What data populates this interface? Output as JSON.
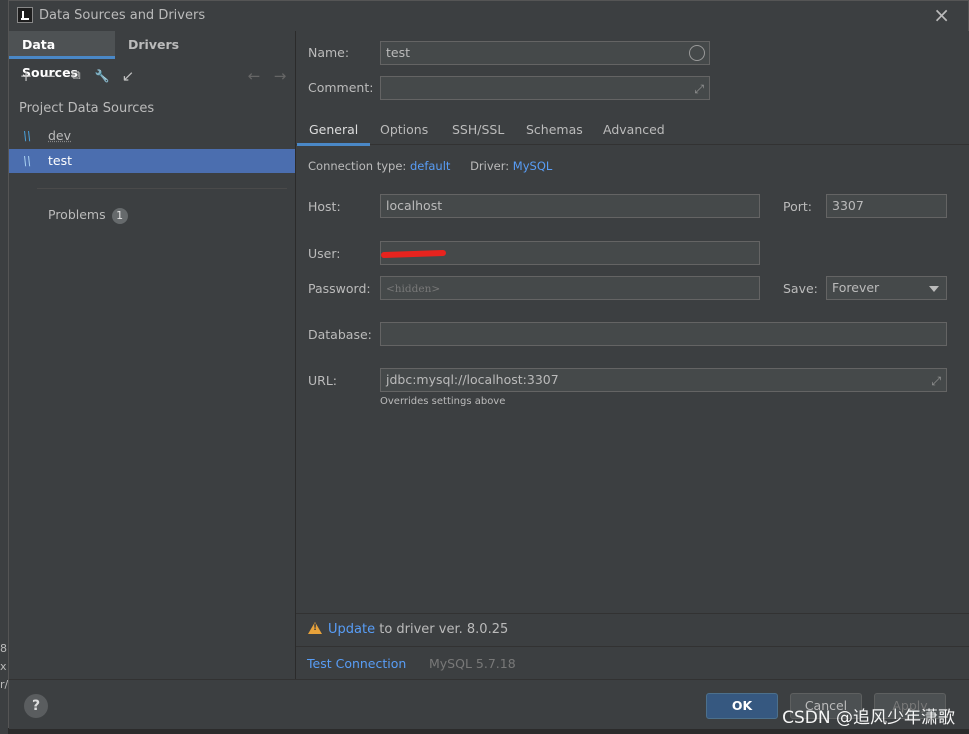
{
  "window": {
    "title": "Data Sources and Drivers"
  },
  "background_fragments": [
    "8",
    "x",
    "r/"
  ],
  "left": {
    "tabs": [
      {
        "label": "Data Sources",
        "active": true
      },
      {
        "label": "Drivers",
        "active": false
      }
    ],
    "toolbar": {
      "add": "+",
      "remove": "−",
      "duplicate": "⧉",
      "properties": "🔧",
      "import": "↙",
      "back": "←",
      "forward": "→"
    },
    "section_title": "Project Data Sources",
    "items": [
      {
        "label": "dev",
        "icon": "mysql-icon",
        "selected": false
      },
      {
        "label": "test",
        "icon": "mysql-icon",
        "selected": true
      }
    ],
    "problems": {
      "label": "Problems",
      "count": "1"
    }
  },
  "form": {
    "name_label": "Name:",
    "name_value": "test",
    "comment_label": "Comment:",
    "comment_value": "",
    "tabs": [
      {
        "label": "General",
        "active": true
      },
      {
        "label": "Options",
        "active": false
      },
      {
        "label": "SSH/SSL",
        "active": false
      },
      {
        "label": "Schemas",
        "active": false
      },
      {
        "label": "Advanced",
        "active": false
      }
    ],
    "conn_type_label": "Connection type:",
    "conn_type_value": "default",
    "driver_label": "Driver:",
    "driver_value": "MySQL",
    "host_label": "Host:",
    "host_value": "localhost",
    "port_label": "Port:",
    "port_value": "3307",
    "user_label": "User:",
    "user_value": "",
    "password_label": "Password:",
    "password_placeholder": "<hidden>",
    "save_label": "Save:",
    "save_value": "Forever",
    "database_label": "Database:",
    "database_value": "",
    "url_label": "URL:",
    "url_value": "jdbc:mysql://localhost:3307",
    "url_hint": "Overrides settings above"
  },
  "notice": {
    "link": "Update",
    "text": " to driver ver. 8.0.25"
  },
  "status": {
    "test_connection": "Test Connection",
    "server_version": "MySQL 5.7.18"
  },
  "footer": {
    "help": "?",
    "ok": "OK",
    "cancel": "Cancel",
    "apply": "Apply"
  },
  "watermark": "CSDN @追风少年潇歌",
  "colors": {
    "accent": "#4a88c7",
    "selection": "#4b6eaf",
    "link": "#589df6",
    "warning": "#e8a23a",
    "background": "#3c3f41"
  }
}
